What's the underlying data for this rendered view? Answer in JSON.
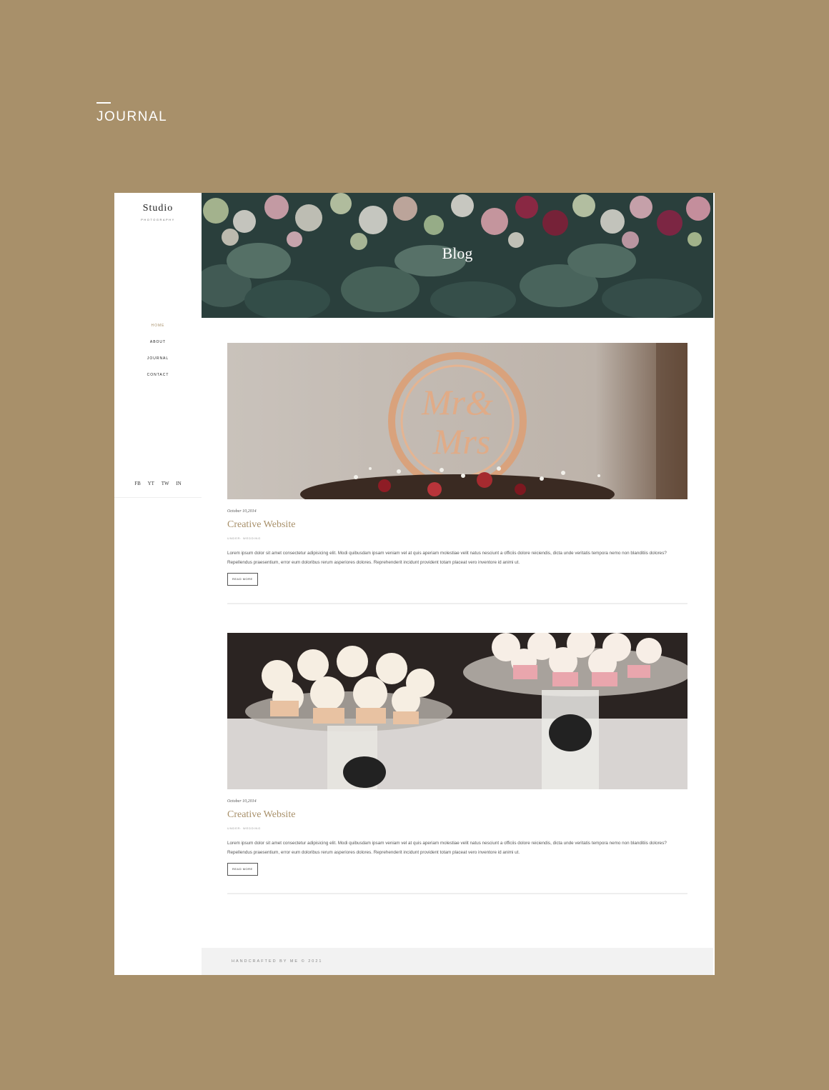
{
  "page_heading": {
    "label": "JOURNAL"
  },
  "brand": {
    "name": "Studio",
    "subtitle": "PHOTOGRAPHY"
  },
  "nav": {
    "items": [
      {
        "label": "HOME",
        "active": true
      },
      {
        "label": "ABOUT",
        "active": false
      },
      {
        "label": "JOURNAL",
        "active": false
      },
      {
        "label": "CONTACT",
        "active": false
      }
    ]
  },
  "social": {
    "items": [
      "FB",
      "YT",
      "TW",
      "IN"
    ]
  },
  "hero": {
    "title": "Blog",
    "image": "flower-wall-photo"
  },
  "posts": [
    {
      "image": "mr-mrs-cake-topper-photo",
      "date": "October 10,2014",
      "title": "Creative Website",
      "meta": "UNDER: WEDDING",
      "excerpt": "Lorem ipsum dolor sit amet consectetur adipisicing elit. Modi quibusdam ipsam veniam vel at quis aperiam molestiae velit natus nesciunt a officiis dolore reiciendis, dicta unde veritatis tempora nemo non blanditiis dolores? Repellendus praesentium, error eum doloribus rerum asperiores dolores. Reprehenderit incidunt provident totam placeat vero inventore id animi ut.",
      "button": "READ MORE"
    },
    {
      "image": "cupcakes-photo",
      "date": "October 10,2014",
      "title": "Creative Website",
      "meta": "UNDER: WEDDING",
      "excerpt": "Lorem ipsum dolor sit amet consectetur adipisicing elit. Modi quibusdam ipsam veniam vel at quis aperiam molestiae velit natus nesciunt a officiis dolore reiciendis, dicta unde veritatis tempora nemo non blanditiis dolores? Repellendus praesentium, error eum doloribus rerum asperiores dolores. Reprehenderit incidunt provident totam placeat vero inventore id animi ut.",
      "button": "READ MORE"
    }
  ],
  "footer": {
    "text": "HANDCRAFTED BY ME © 2021"
  },
  "colors": {
    "background": "#a8906a",
    "accent": "#a8906a",
    "footer_bg": "#f2f2f2"
  }
}
